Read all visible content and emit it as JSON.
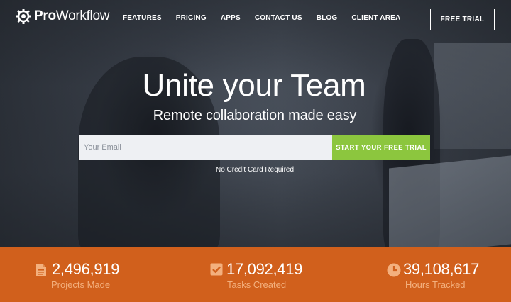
{
  "brand": {
    "name_bold": "Pro",
    "name_rest": "Workflow"
  },
  "nav": {
    "links": [
      "FEATURES",
      "PRICING",
      "APPS",
      "CONTACT US",
      "BLOG",
      "CLIENT AREA"
    ],
    "cta": "FREE TRIAL"
  },
  "hero": {
    "title": "Unite your Team",
    "subtitle": "Remote collaboration made easy",
    "email_placeholder": "Your Email",
    "submit": "START YOUR FREE TRIAL",
    "note": "No Credit Card Required"
  },
  "stats": [
    {
      "icon": "document-icon",
      "value": "2,496,919",
      "label": "Projects Made"
    },
    {
      "icon": "checkbox-icon",
      "value": "17,092,419",
      "label": "Tasks Created"
    },
    {
      "icon": "clock-icon",
      "value": "39,108,617",
      "label": "Hours Tracked"
    }
  ],
  "colors": {
    "accent_green": "#8cc63e",
    "stats_orange": "#d1601c",
    "stats_label": "#f3b07e"
  }
}
